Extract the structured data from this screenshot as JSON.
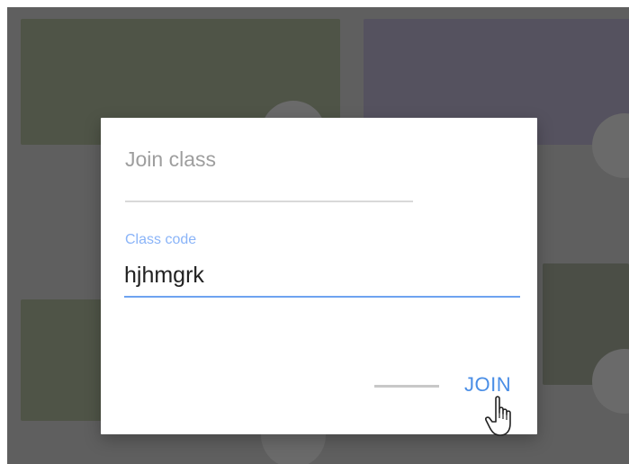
{
  "dialog": {
    "title": "Join class",
    "field": {
      "label": "Class code",
      "value": "hjhmgrk"
    },
    "actions": {
      "join_label": "JOIN"
    }
  },
  "cursor": {
    "icon": "hand-pointer-icon"
  },
  "colors": {
    "accent": "#4a8ee6",
    "label_accent": "#8ab4f8",
    "backdrop": "#5f5f5f"
  }
}
